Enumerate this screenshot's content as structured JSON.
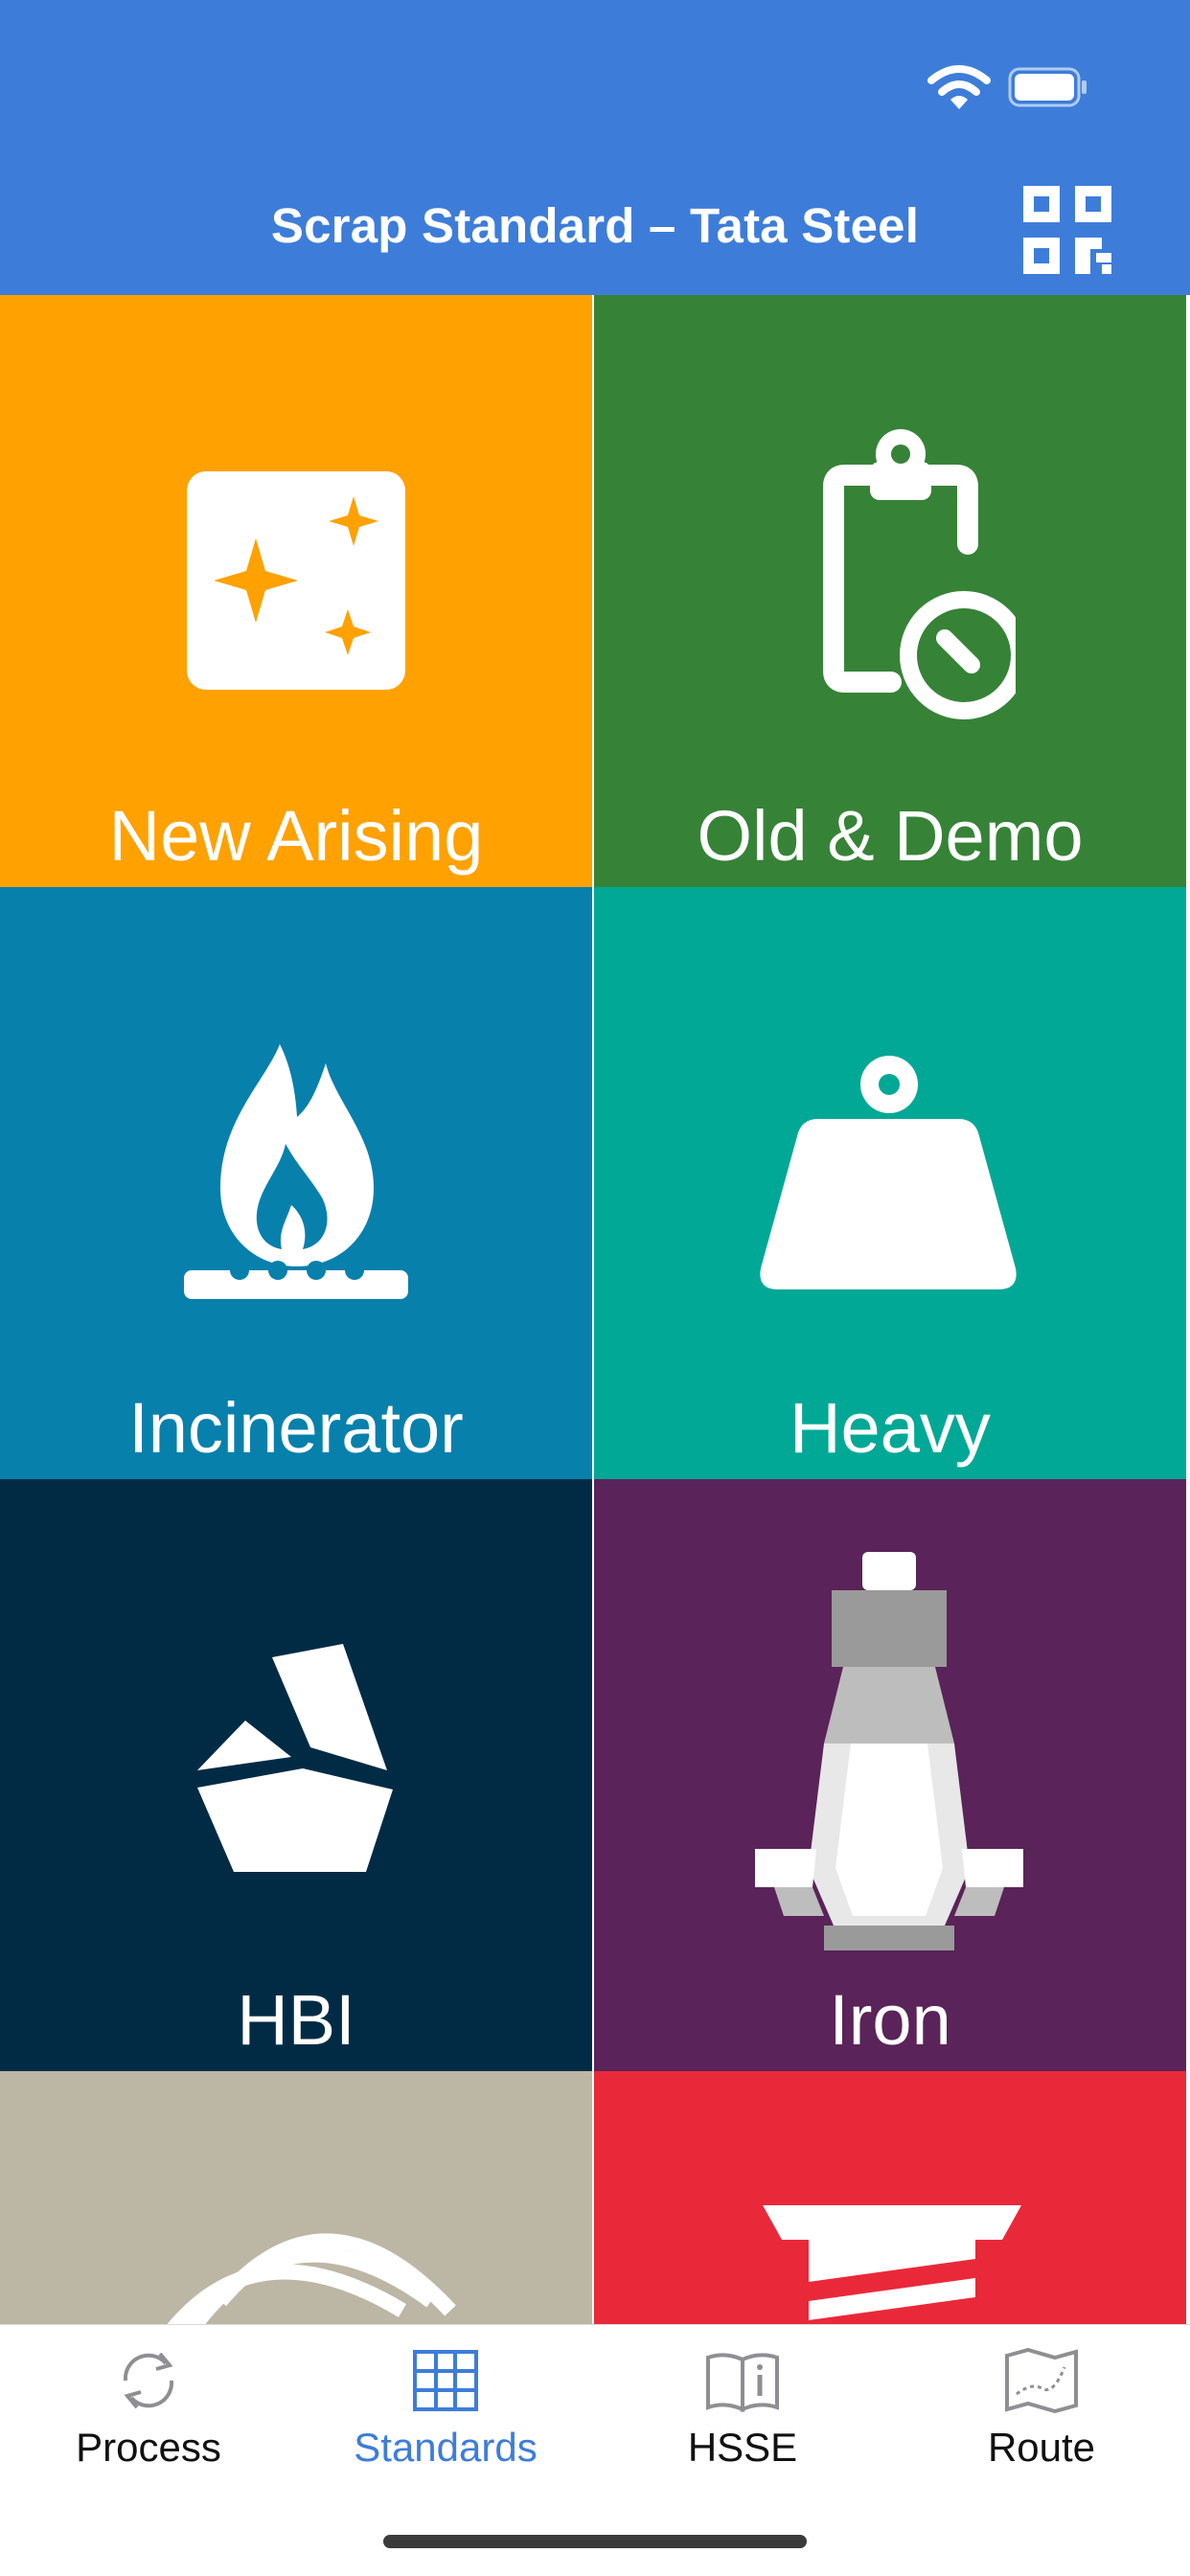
{
  "header": {
    "title": "Scrap Standard – Tata Steel",
    "background": "#3d7dd9"
  },
  "status_bar": {
    "icons": [
      "wifi-icon",
      "battery-icon"
    ]
  },
  "tiles": [
    {
      "label": "New Arising",
      "color": "#ffa101",
      "icon": "sparkles-icon"
    },
    {
      "label": "Old & Demo",
      "color": "#368337",
      "icon": "clipboard-timer-icon"
    },
    {
      "label": "Incinerator",
      "color": "#0880ac",
      "icon": "gas-flame-icon"
    },
    {
      "label": "Heavy",
      "color": "#02a896",
      "icon": "weight-icon"
    },
    {
      "label": "HBI",
      "color": "#012b45",
      "icon": "briquette-icon"
    },
    {
      "label": "Iron",
      "color": "#5a2359",
      "icon": "converter-icon"
    },
    {
      "label": "",
      "color": "#bcb6a5",
      "icon": "coil-icon"
    },
    {
      "label": "",
      "color": "#e92939",
      "icon": "spring-icon"
    }
  ],
  "tabbar": {
    "tabs": [
      {
        "label": "Process",
        "icon": "refresh-icon",
        "active": false
      },
      {
        "label": "Standards",
        "icon": "table-grid-icon",
        "active": true
      },
      {
        "label": "HSSE",
        "icon": "book-info-icon",
        "active": false
      },
      {
        "label": "Route",
        "icon": "map-route-icon",
        "active": false
      }
    ],
    "active_color": "#3d7dd9",
    "inactive_color": "#8e8e93"
  }
}
